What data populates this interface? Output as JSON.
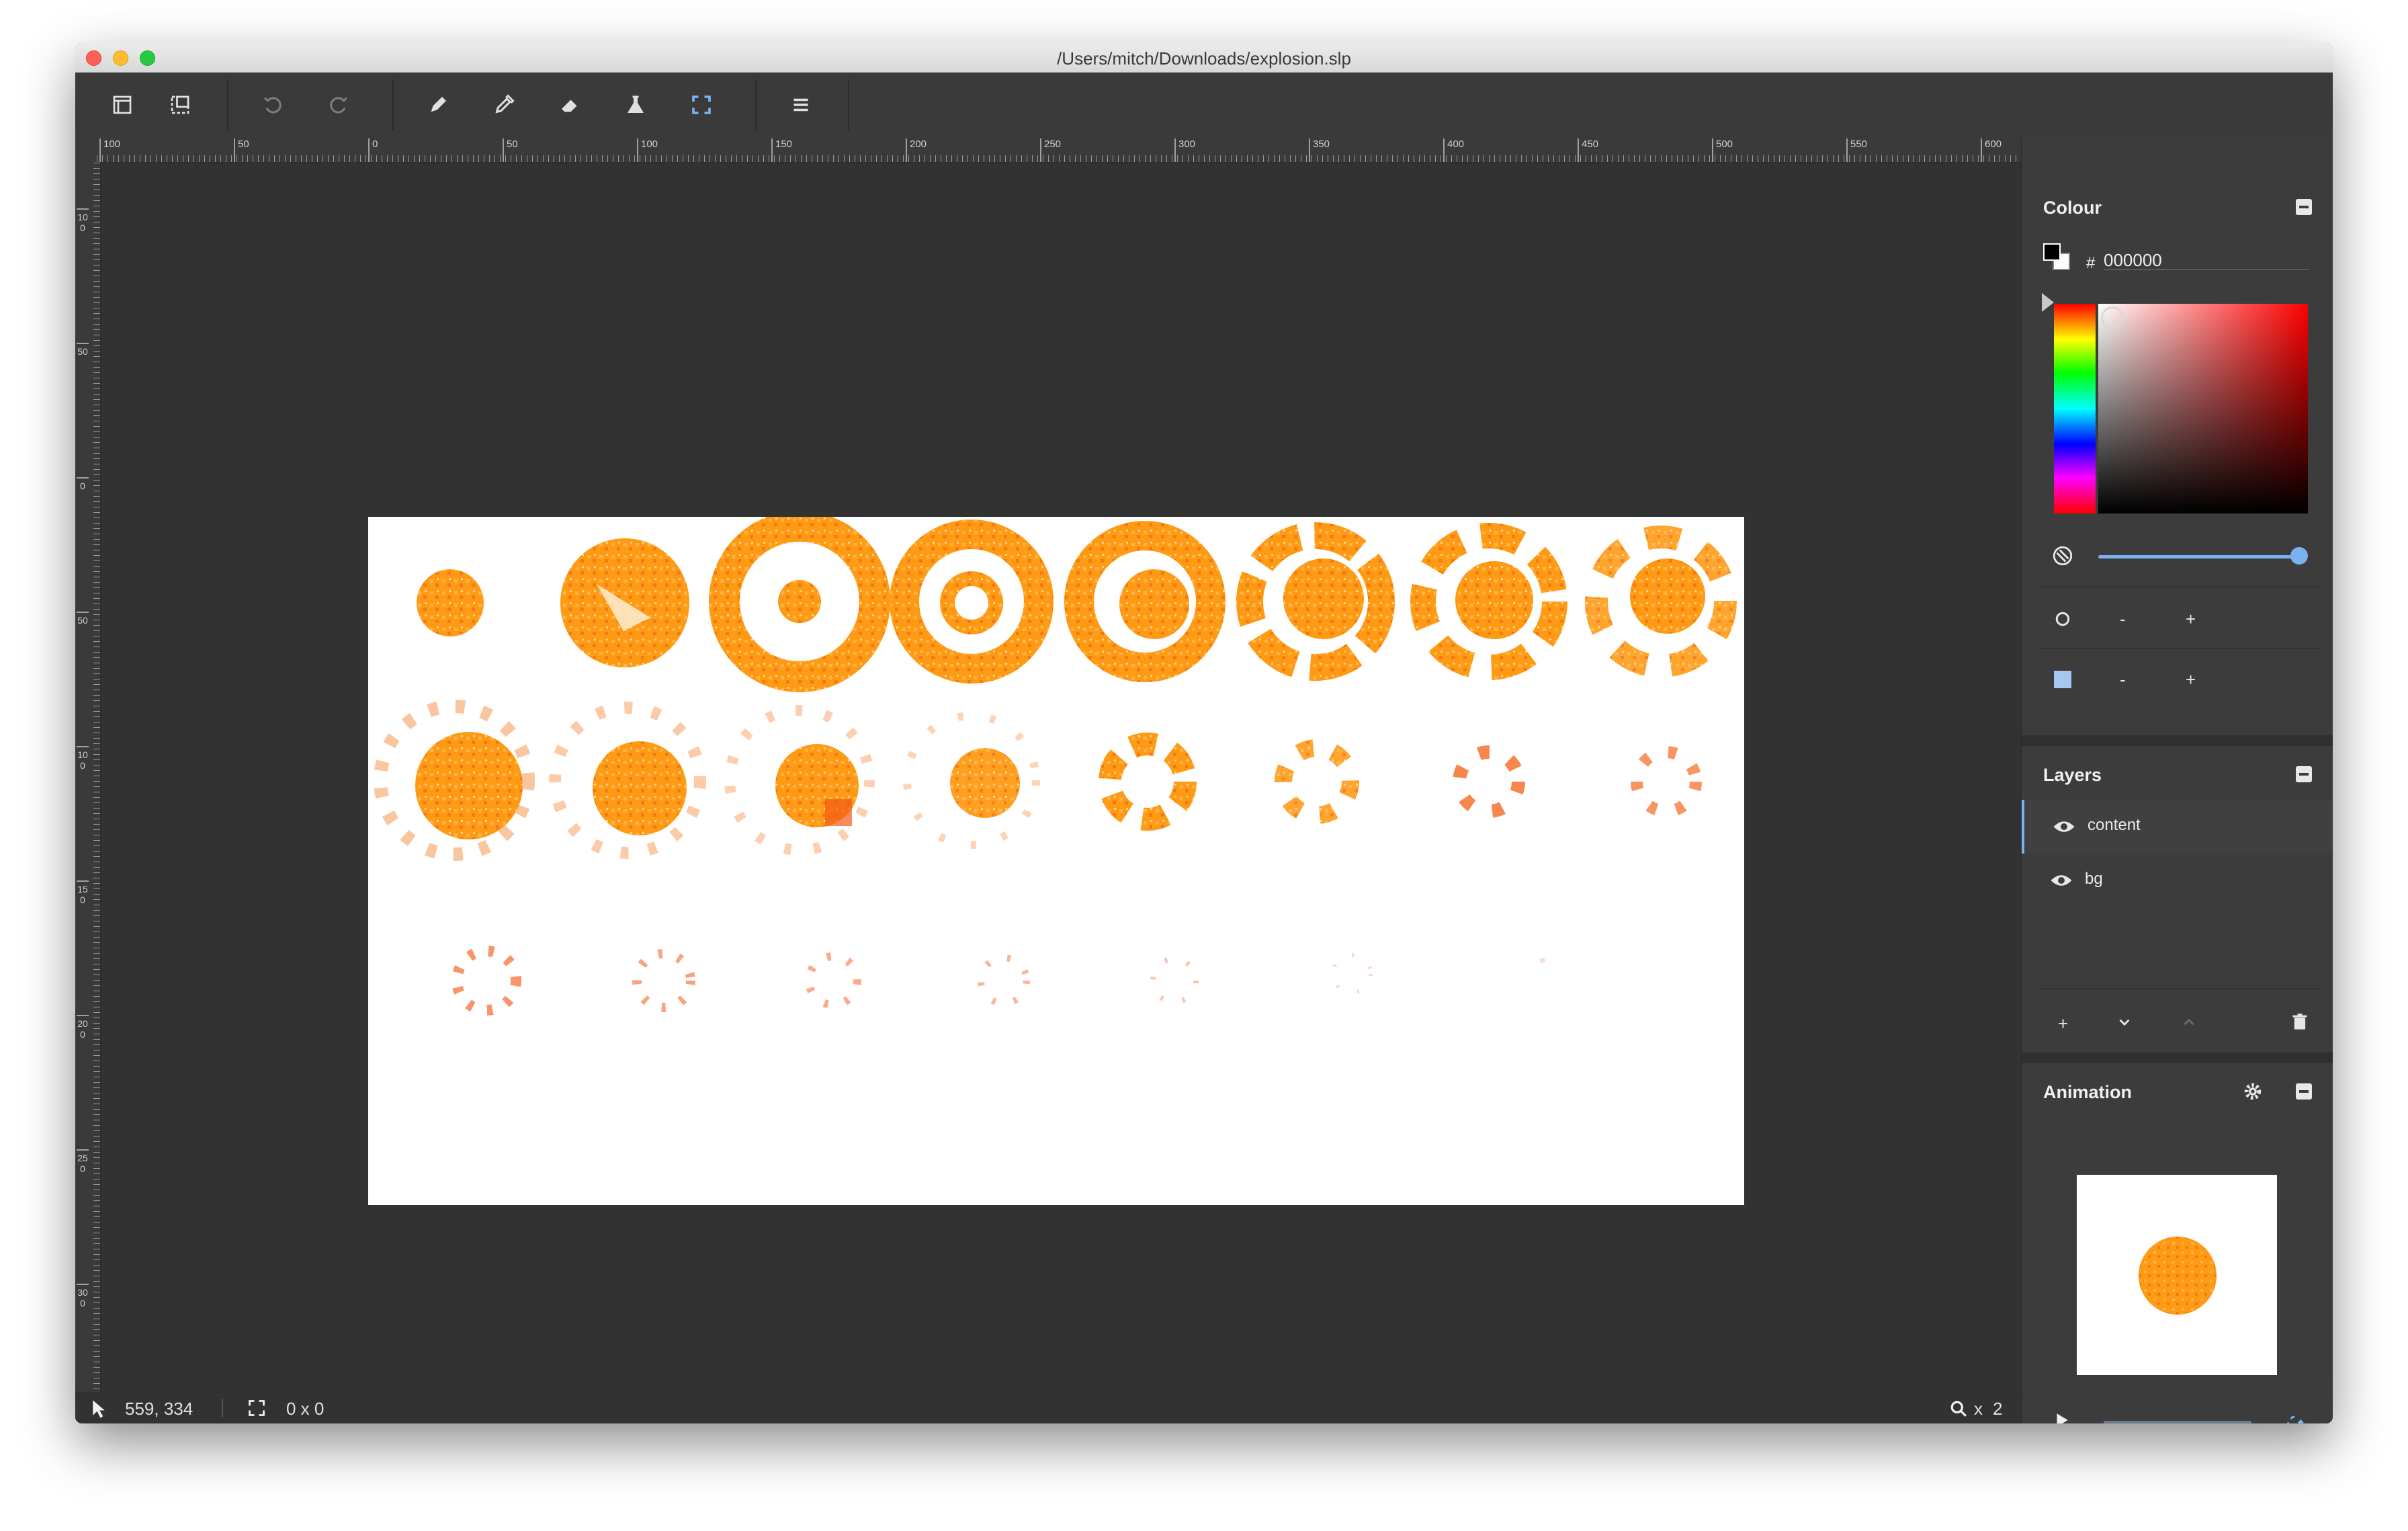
{
  "window": {
    "title": "/Users/mitch/Downloads/explosion.slp"
  },
  "toolbar": {
    "items": [
      {
        "icon": "new-document-icon"
      },
      {
        "icon": "export-icon"
      },
      {
        "icon": "undo-icon"
      },
      {
        "icon": "redo-icon"
      },
      {
        "icon": "pencil-icon"
      },
      {
        "icon": "eyedropper-icon"
      },
      {
        "icon": "eraser-icon"
      },
      {
        "icon": "fill-flask-icon"
      },
      {
        "icon": "selection-icon"
      },
      {
        "icon": "menu-icon"
      }
    ]
  },
  "rulers": {
    "horizontal": [
      "100",
      "50",
      "0",
      "50",
      "100",
      "150",
      "200",
      "250",
      "300",
      "350",
      "400",
      "450",
      "500",
      "550",
      "600"
    ],
    "vertical": [
      "100",
      "50",
      "0",
      "50",
      "100",
      "150",
      "200",
      "250",
      "300"
    ]
  },
  "status": {
    "cursor_position": "559, 334",
    "selection_size": "0 x 0",
    "zoom_prefix": "x",
    "zoom_level": "2"
  },
  "colour_panel": {
    "title": "Colour",
    "hash": "#",
    "hex_value": "000000",
    "foreground": "#000000",
    "background": "#ffffff",
    "brush_minus": "-",
    "brush_plus": "+",
    "pixel_minus": "-",
    "pixel_plus": "+"
  },
  "layers_panel": {
    "title": "Layers",
    "layers": [
      {
        "name": "content",
        "active": true
      },
      {
        "name": "bg",
        "active": false
      }
    ],
    "add_label": "+"
  },
  "animation_panel": {
    "title": "Animation"
  },
  "colors": {
    "accent": "#79b4f5",
    "explosion_orange": "#ff9a14",
    "explosion_red": "#f45a16"
  }
}
